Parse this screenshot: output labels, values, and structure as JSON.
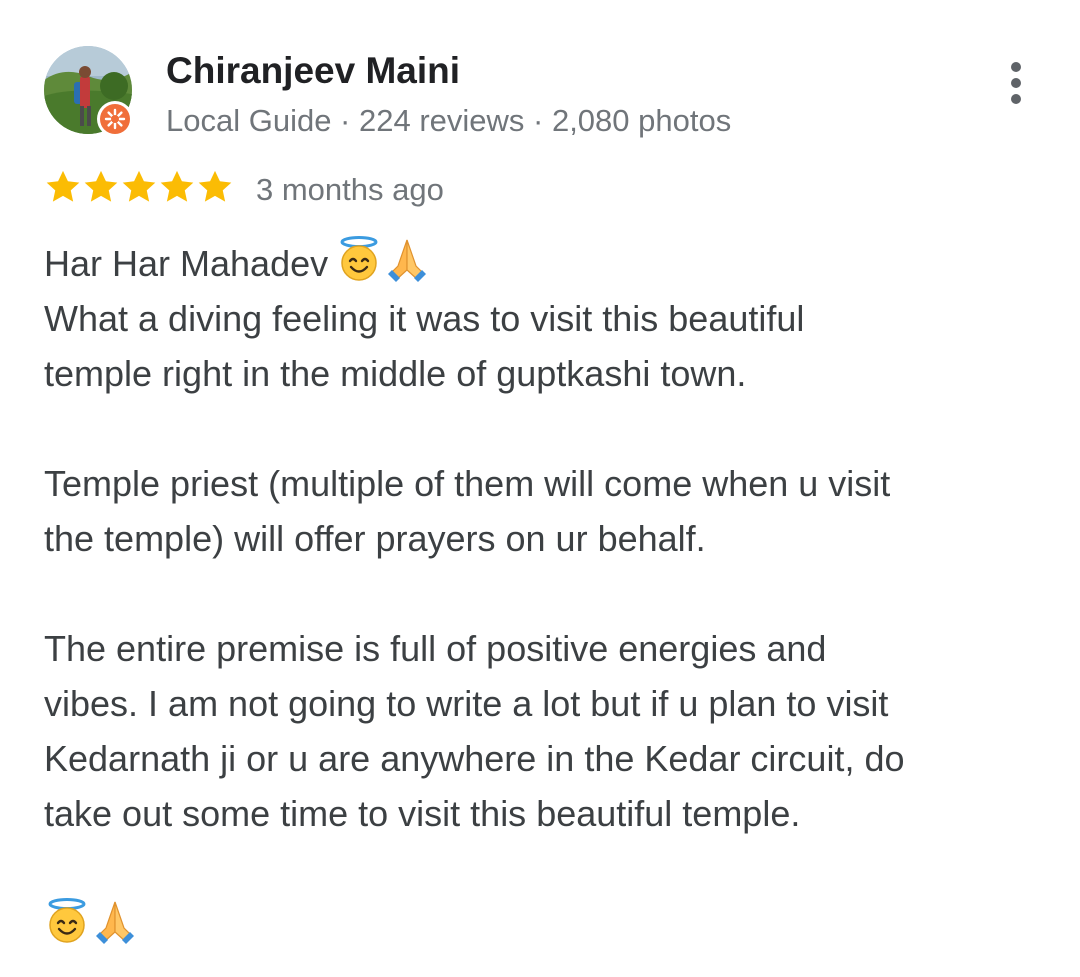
{
  "review": {
    "author": {
      "name": "Chiranjeev Maini",
      "meta": "Local Guide · 224 reviews · 2,080 photos",
      "avatar_icon": "profile-photo",
      "badge_icon": "local-guide-badge-icon"
    },
    "rating": {
      "stars": 5,
      "max_stars": 5,
      "star_color": "#fbbc04",
      "time_ago": "3 months ago"
    },
    "more_icon": "more-vert-icon",
    "text": {
      "p1_line1": "Har Har Mahadev",
      "p1_line2": "What a diving feeling it was to visit this beautiful",
      "p1_line3": "temple right in the middle of guptkashi town.",
      "p2_line1": "Temple priest (multiple of them will come when u visit",
      "p2_line2": "the temple) will offer prayers on ur behalf.",
      "p3_line1": "The entire premise is full of positive energies and",
      "p3_line2": "vibes. I am not going to write a lot but if u plan to visit",
      "p3_line3": "Kedarnath ji or u are anywhere in the Kedar circuit, do",
      "p3_line4": "take out some time to visit this beautiful temple."
    },
    "emoji_icons": [
      "smiling-face-with-halo-icon",
      "folded-hands-icon"
    ]
  }
}
